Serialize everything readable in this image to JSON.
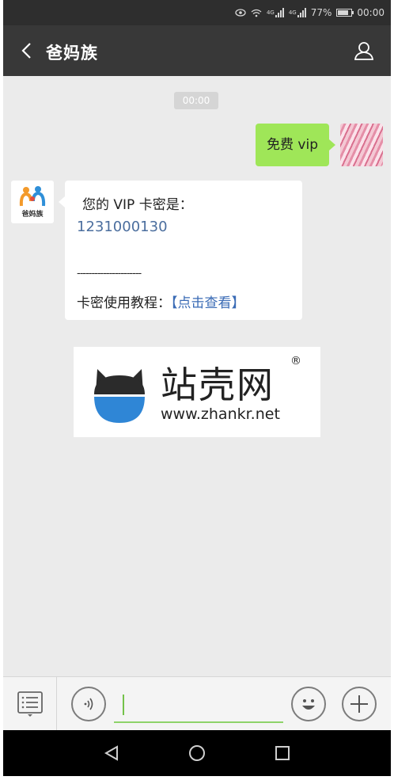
{
  "status_bar": {
    "network_1": "4G",
    "network_2": "4G",
    "battery": "77%",
    "time": "00:00"
  },
  "header": {
    "back_icon": "chevron-left-icon",
    "title": "爸妈族",
    "profile_icon": "person-icon"
  },
  "chat": {
    "timestamp": "00:00",
    "outgoing": {
      "text": "免费 vip"
    },
    "incoming": {
      "avatar_caption": "爸妈族",
      "line1": "您的 VIP 卡密是：",
      "card_code": "1231000130",
      "separator": "----------------------",
      "tutorial_prefix": "卡密使用教程：",
      "tutorial_link": "【点击查看】"
    },
    "banner": {
      "brand": "站壳网",
      "registered": "®",
      "url": "www.zhankr.net"
    }
  },
  "input_bar": {
    "menu_icon": "list-menu-icon",
    "voice_icon": "voice-icon",
    "emoji_icon": "smiley-icon",
    "plus_icon": "plus-icon",
    "text_value": ""
  },
  "nav_bar": {
    "back": "triangle-back-icon",
    "home": "circle-home-icon",
    "recents": "square-recents-icon"
  },
  "colors": {
    "green_bubble": "#9fe658",
    "link_blue": "#3a6bb5",
    "code_blue": "#4b6e9e",
    "header_bg": "#383838",
    "chat_bg": "#ebebeb"
  }
}
